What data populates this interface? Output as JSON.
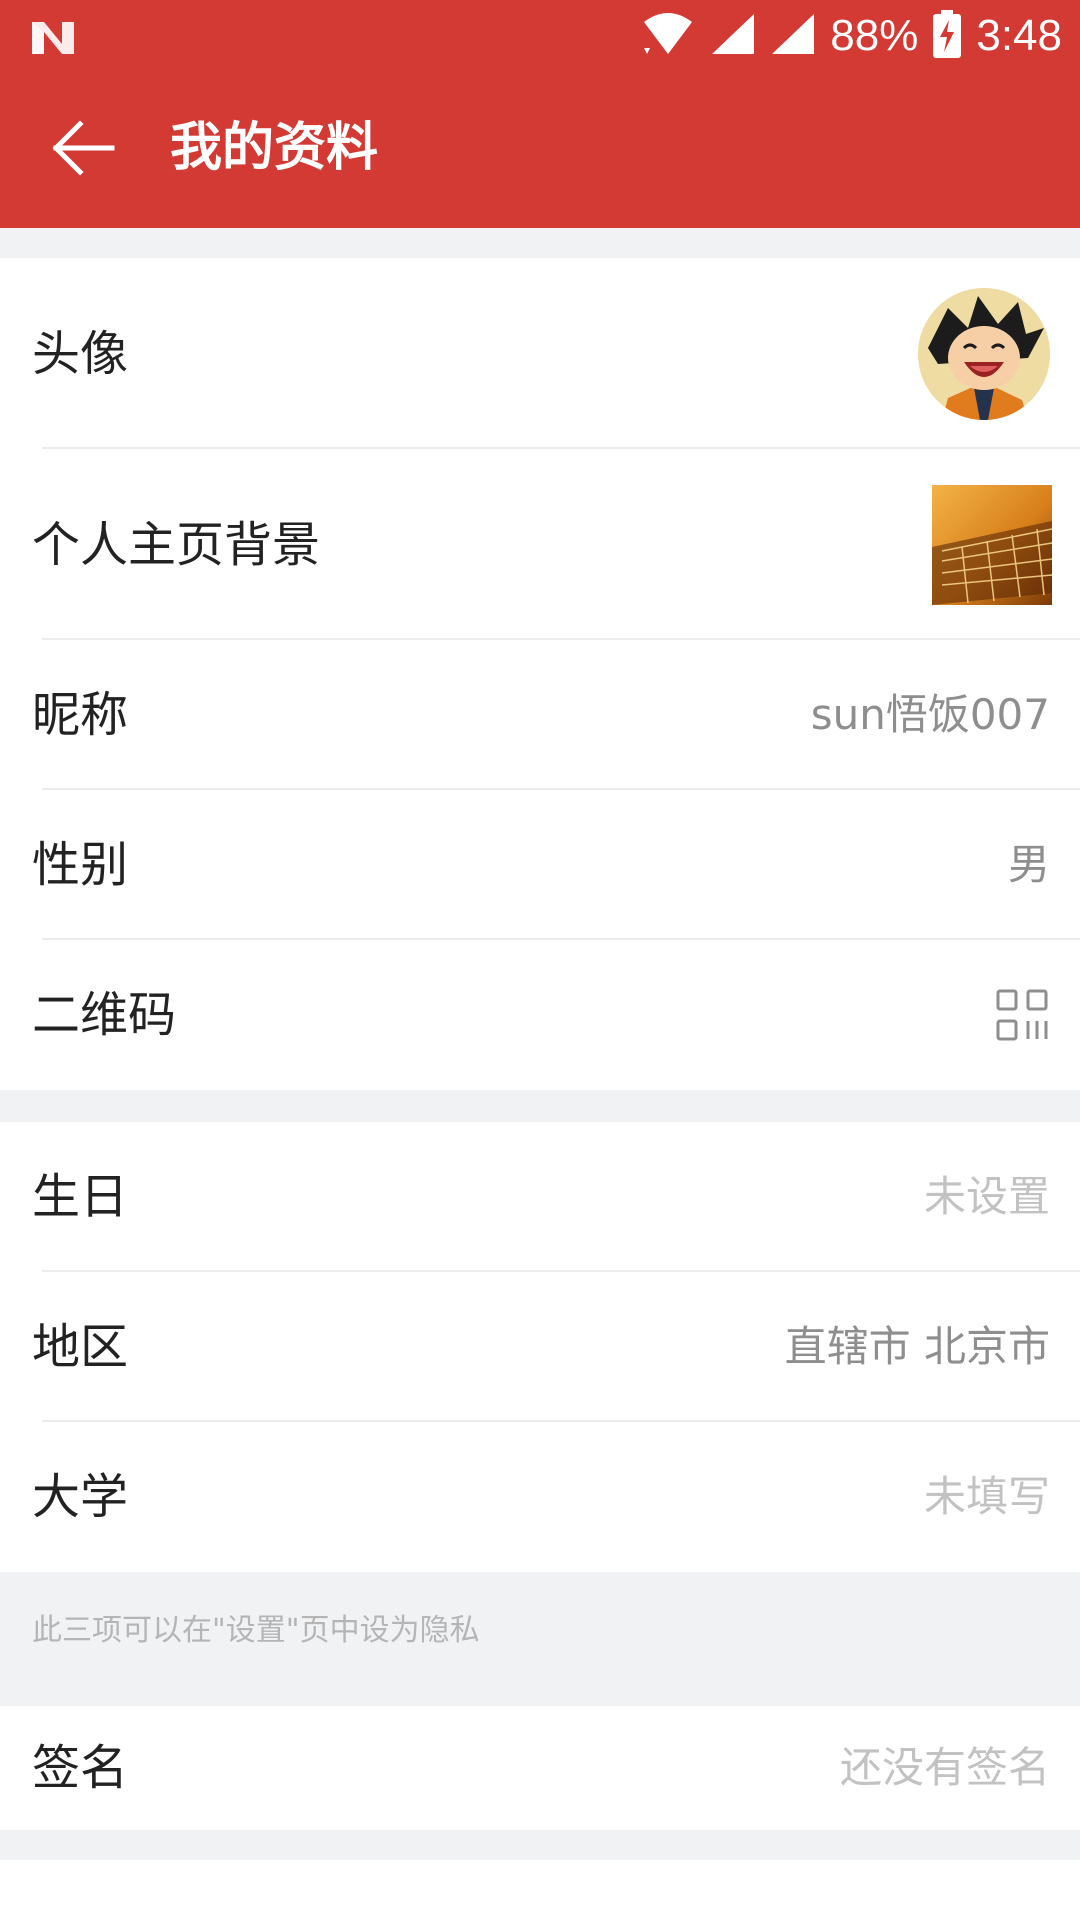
{
  "status_bar": {
    "battery": "88%",
    "time": "3:48"
  },
  "header": {
    "title": "我的资料"
  },
  "profile": {
    "avatar_label": "头像",
    "background_label": "个人主页背景",
    "nickname_label": "昵称",
    "nickname_value": "sun悟饭007",
    "gender_label": "性别",
    "gender_value": "男",
    "qrcode_label": "二维码"
  },
  "details": {
    "birthday_label": "生日",
    "birthday_value": "未设置",
    "region_label": "地区",
    "region_value": "直辖市 北京市",
    "university_label": "大学",
    "university_value": "未填写",
    "privacy_note": "此三项可以在\"设置\"页中设为隐私"
  },
  "signature": {
    "label": "签名",
    "value": "还没有签名"
  },
  "colors": {
    "accent": "#d33a34",
    "background": "#f1f2f4"
  }
}
